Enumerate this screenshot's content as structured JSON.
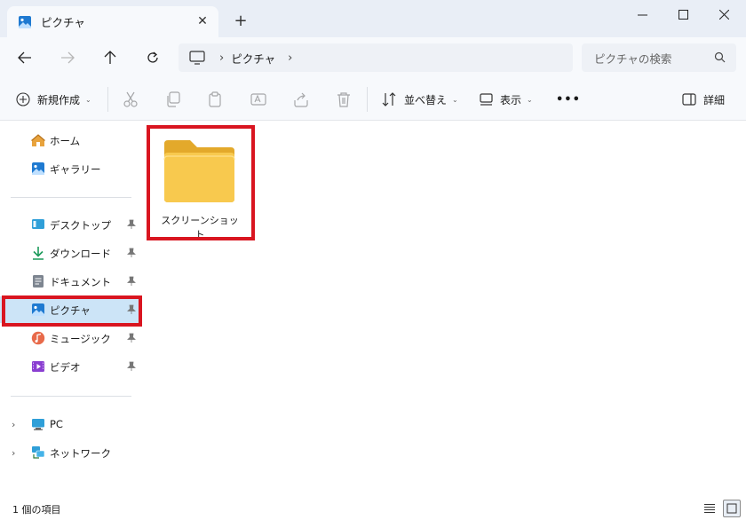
{
  "tab": {
    "title": "ピクチャ"
  },
  "address": {
    "location": "ピクチャ"
  },
  "search": {
    "placeholder": "ピクチャの検索"
  },
  "toolbar": {
    "new_label": "新規作成",
    "sort_label": "並べ替え",
    "view_label": "表示",
    "more_label": "•••",
    "details_label": "詳細"
  },
  "sidebar": {
    "home": "ホーム",
    "gallery": "ギャラリー",
    "desktop": "デスクトップ",
    "downloads": "ダウンロード",
    "documents": "ドキュメント",
    "pictures": "ピクチャ",
    "music": "ミュージック",
    "videos": "ビデオ",
    "pc": "PC",
    "network": "ネットワーク"
  },
  "content": {
    "items": [
      {
        "name": "スクリーンショット",
        "type": "folder"
      }
    ]
  },
  "status": {
    "count": "1 個の項目"
  },
  "colors": {
    "accent": "#0067c0",
    "selected": "#cce4f7",
    "highlight": "#d91520",
    "folder": "#f8c94e"
  }
}
